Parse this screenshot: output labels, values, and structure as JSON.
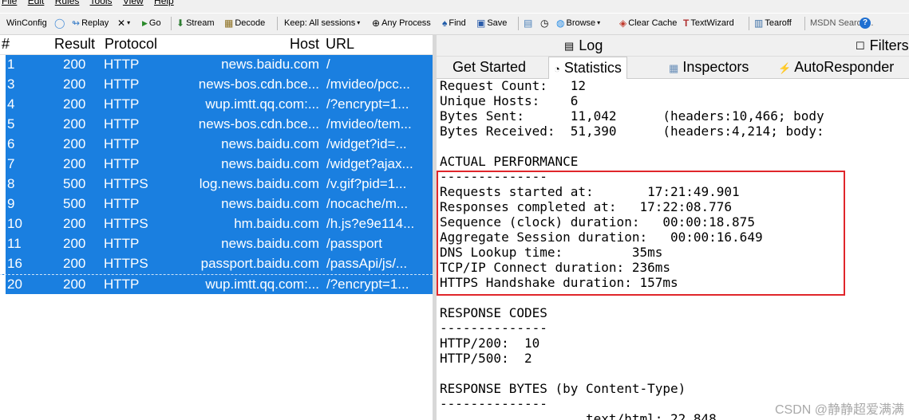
{
  "menu": {
    "items": [
      "File",
      "Edit",
      "Rules",
      "Tools",
      "View",
      "Help"
    ]
  },
  "toolbar": {
    "winconfig": "WinConfig",
    "replay": "Replay",
    "go": "Go",
    "stream": "Stream",
    "decode": "Decode",
    "keep": "Keep: All sessions",
    "process": "Any Process",
    "find": "Find",
    "save": "Save",
    "browse": "Browse",
    "clear_cache": "Clear Cache",
    "textwizard": "TextWizard",
    "tearoff": "Tearoff",
    "search_placeholder": "MSDN Search..."
  },
  "sessions": {
    "columns": {
      "id": "#",
      "result": "Result",
      "protocol": "Protocol",
      "host": "Host",
      "url": "URL"
    },
    "rows": [
      {
        "id": "1",
        "result": "200",
        "protocol": "HTTP",
        "host": "news.baidu.com",
        "url": "/"
      },
      {
        "id": "3",
        "result": "200",
        "protocol": "HTTP",
        "host": "news-bos.cdn.bce...",
        "url": "/mvideo/pcc..."
      },
      {
        "id": "4",
        "result": "200",
        "protocol": "HTTP",
        "host": "wup.imtt.qq.com:...",
        "url": "/?encrypt=1..."
      },
      {
        "id": "5",
        "result": "200",
        "protocol": "HTTP",
        "host": "news-bos.cdn.bce...",
        "url": "/mvideo/tem..."
      },
      {
        "id": "6",
        "result": "200",
        "protocol": "HTTP",
        "host": "news.baidu.com",
        "url": "/widget?id=..."
      },
      {
        "id": "7",
        "result": "200",
        "protocol": "HTTP",
        "host": "news.baidu.com",
        "url": "/widget?ajax..."
      },
      {
        "id": "8",
        "result": "500",
        "protocol": "HTTPS",
        "host": "log.news.baidu.com",
        "url": "/v.gif?pid=1..."
      },
      {
        "id": "9",
        "result": "500",
        "protocol": "HTTP",
        "host": "news.baidu.com",
        "url": "/nocache/m..."
      },
      {
        "id": "10",
        "result": "200",
        "protocol": "HTTPS",
        "host": "hm.baidu.com",
        "url": "/h.js?e9e114..."
      },
      {
        "id": "11",
        "result": "200",
        "protocol": "HTTP",
        "host": "news.baidu.com",
        "url": "/passport"
      },
      {
        "id": "16",
        "result": "200",
        "protocol": "HTTPS",
        "host": "passport.baidu.com",
        "url": "/passApi/js/..."
      },
      {
        "id": "20",
        "result": "200",
        "protocol": "HTTP",
        "host": "wup.imtt.qq.com:...",
        "url": "/?encrypt=1..."
      }
    ]
  },
  "right": {
    "log_label": "Log",
    "filters_label": "Filters",
    "tabs": [
      {
        "label": "Get Started"
      },
      {
        "label": "Statistics"
      },
      {
        "label": "Inspectors"
      },
      {
        "label": "AutoResponder"
      }
    ],
    "stats_lines": [
      "Request Count:   12",
      "Unique Hosts:    6",
      "Bytes Sent:      11,042      (headers:10,466; body",
      "Bytes Received:  51,390      (headers:4,214; body:",
      "",
      "ACTUAL PERFORMANCE",
      "--------------",
      "Requests started at:       17:21:49.901",
      "Responses completed at:   17:22:08.776",
      "Sequence (clock) duration:   00:00:18.875",
      "Aggregate Session duration:   00:00:16.649",
      "DNS Lookup time:         35ms",
      "TCP/IP Connect duration: 236ms",
      "HTTPS Handshake duration: 157ms",
      "",
      "RESPONSE CODES",
      "--------------",
      "HTTP/200:  10",
      "HTTP/500:  2",
      "",
      "RESPONSE BYTES (by Content-Type)",
      "--------------",
      "                   text/html: 22,848"
    ],
    "watermark": "CSDN @静静超爱满满"
  },
  "colors": {
    "selection": "#1a7fe0",
    "highlight_border": "#e0262b"
  }
}
